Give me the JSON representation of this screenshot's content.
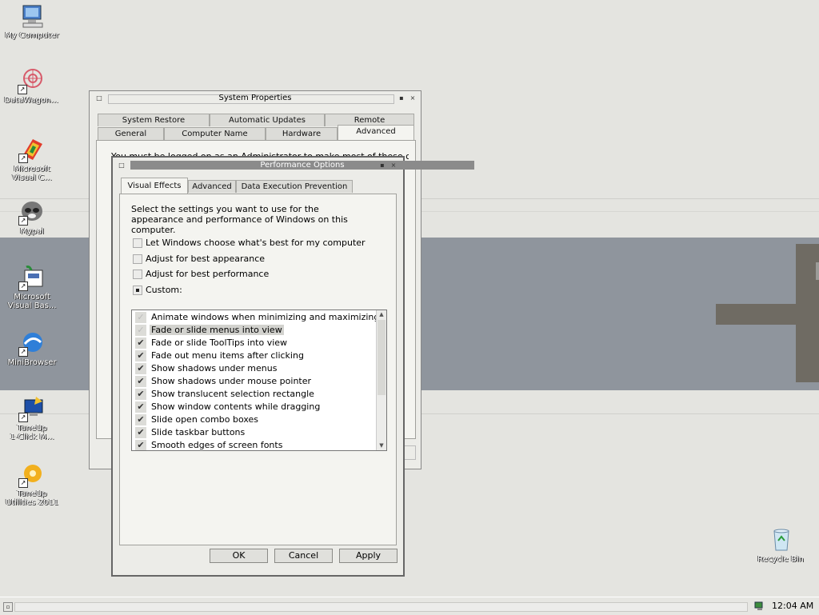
{
  "desktop": {
    "icons": [
      {
        "label": "My Computer"
      },
      {
        "label": "DataWagon..."
      },
      {
        "label": "Microsoft\nVisual C..."
      },
      {
        "label": "Mypal"
      },
      {
        "label": "Microsoft\nVisual Bas..."
      },
      {
        "label": "MiniBrowser"
      },
      {
        "label": "TuneUp\n1-Click M..."
      },
      {
        "label": "TuneUp\nUtilities 2011"
      },
      {
        "label": "Recycle Bin"
      }
    ]
  },
  "system_properties": {
    "title": "System Properties",
    "tabs_row1": [
      "System Restore",
      "Automatic Updates",
      "Remote"
    ],
    "tabs_row2": [
      "General",
      "Computer Name",
      "Hardware",
      "Advanced"
    ],
    "active_tab": "Advanced",
    "partial_text": "You must be logged on as an Administrator to make most of these changes."
  },
  "performance_options": {
    "title": "Performance Options",
    "tabs": [
      "Visual Effects",
      "Advanced",
      "Data Execution Prevention"
    ],
    "active_tab": "Visual Effects",
    "description": "Select the settings you want to use for the appearance and performance of Windows on this computer.",
    "options": [
      {
        "label": "Let Windows choose what's best for my computer",
        "checked": false
      },
      {
        "label": "Adjust for best appearance",
        "checked": false
      },
      {
        "label": "Adjust for best performance",
        "checked": false
      },
      {
        "label": "Custom:",
        "checked": true
      }
    ],
    "effects": [
      {
        "label": "Animate windows when minimizing and maximizing",
        "checked": false,
        "selected": false
      },
      {
        "label": "Fade or slide menus into view",
        "checked": false,
        "selected": true
      },
      {
        "label": "Fade or slide ToolTips into view",
        "checked": true,
        "selected": false
      },
      {
        "label": "Fade out menu items after clicking",
        "checked": true,
        "selected": false
      },
      {
        "label": "Show shadows under menus",
        "checked": true,
        "selected": false
      },
      {
        "label": "Show shadows under mouse pointer",
        "checked": true,
        "selected": false
      },
      {
        "label": "Show translucent selection rectangle",
        "checked": true,
        "selected": false
      },
      {
        "label": "Show window contents while dragging",
        "checked": true,
        "selected": false
      },
      {
        "label": "Slide open combo boxes",
        "checked": true,
        "selected": false
      },
      {
        "label": "Slide taskbar buttons",
        "checked": true,
        "selected": false
      },
      {
        "label": "Smooth edges of screen fonts",
        "checked": true,
        "selected": false
      }
    ],
    "buttons": {
      "ok": "OK",
      "cancel": "Cancel",
      "apply": "Apply"
    }
  },
  "taskbar": {
    "clock": "12:04 AM"
  }
}
